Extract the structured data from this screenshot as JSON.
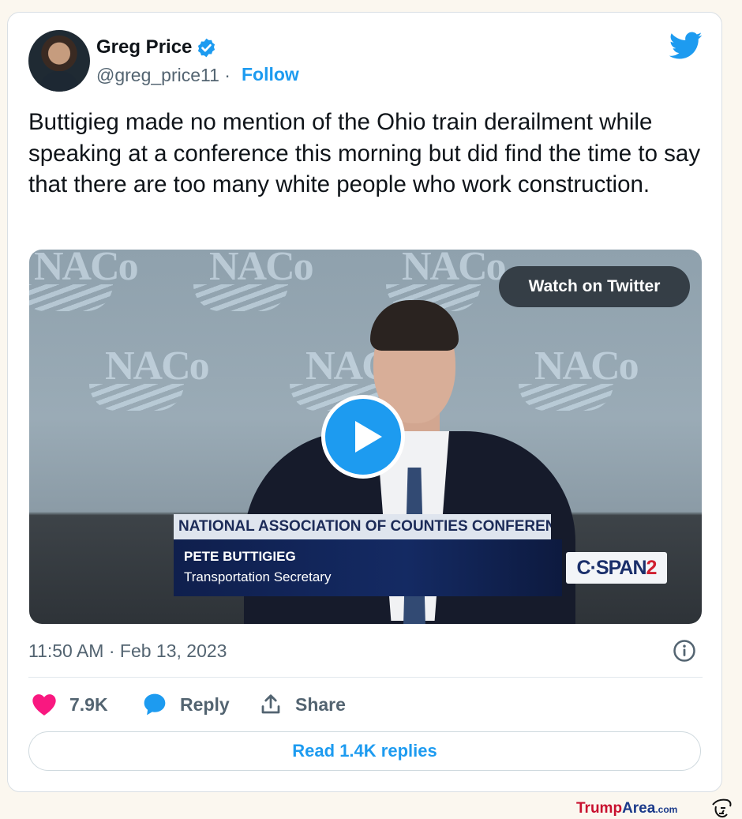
{
  "author": {
    "name": "Greg Price",
    "handle": "@greg_price11 ·",
    "follow_label": "Follow"
  },
  "tweet": {
    "text": "Buttigieg made no mention of the Ohio train derailment while speaking at a conference this morning but did find the time to say that there are too many white people who work construction.",
    "timestamp": "11:50 AM · Feb 13, 2023"
  },
  "video": {
    "watch_label": "Watch on Twitter",
    "backdrop_text": "NACo",
    "chyron_title": "NATIONAL ASSOCIATION OF COUNTIES CONFERENCE",
    "chyron_name": "PETE BUTTIGIEG",
    "chyron_role": "Transportation Secretary",
    "network_main": "C·SPAN",
    "network_num": "2"
  },
  "actions": {
    "likes_count": "7.9K",
    "reply_label": "Reply",
    "share_label": "Share",
    "read_replies_label": "Read 1.4K replies"
  },
  "watermark": {
    "part1": "Trump",
    "part2": "Area",
    "part3": ".com"
  },
  "colors": {
    "accent": "#1d9bf0",
    "like": "#f91880",
    "text_primary": "#0f1419",
    "text_secondary": "#536471"
  },
  "icons": [
    "verified-badge-icon",
    "twitter-bird-icon",
    "play-icon",
    "info-icon",
    "heart-icon",
    "reply-bubble-icon",
    "share-icon"
  ]
}
